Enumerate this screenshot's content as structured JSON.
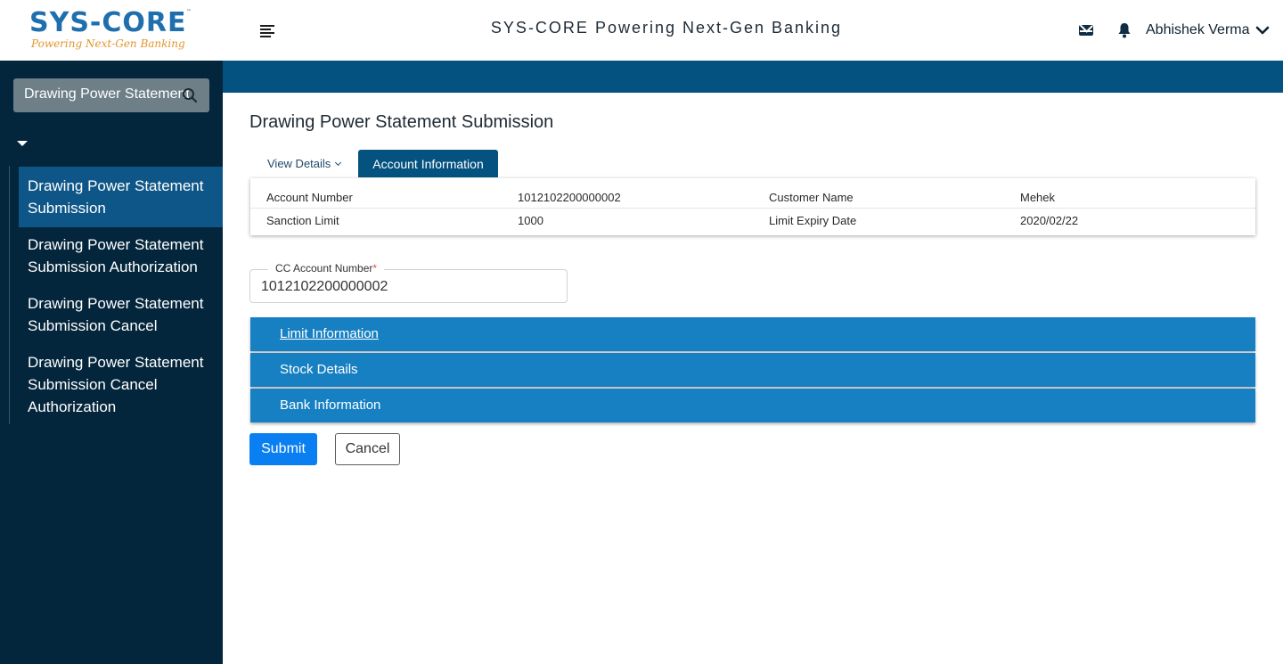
{
  "header": {
    "logo_main": "SYS-CORE",
    "logo_tm": "™",
    "logo_tagline": "Powering Next-Gen Banking",
    "title": "SYS-CORE Powering Next-Gen Banking",
    "user_name": "Abhishek Verma",
    "icons": [
      "menu-icon",
      "mail-icon",
      "bell-icon",
      "chevron-down-icon"
    ]
  },
  "sidebar": {
    "search_value": "Drawing Power Statement",
    "items": [
      {
        "label": "Drawing Power Statement Submission",
        "active": true
      },
      {
        "label": "Drawing Power Statement Submission Authorization",
        "active": false
      },
      {
        "label": "Drawing Power Statement Submission Cancel",
        "active": false
      },
      {
        "label": "Drawing Power Statement Submission Cancel Authorization",
        "active": false
      }
    ]
  },
  "main": {
    "page_title": "Drawing Power Statement Submission",
    "tabs": [
      {
        "label": "View Details"
      },
      {
        "label": "Account Information"
      }
    ],
    "account_info": {
      "rows": [
        [
          "Account Number",
          "1012102200000002",
          "Customer Name",
          "Mehek"
        ],
        [
          "Sanction Limit",
          "1000",
          "Limit Expiry Date",
          "2020/02/22"
        ]
      ]
    },
    "cc_account": {
      "label": "CC Account Number",
      "required_mark": "*",
      "value": "1012102200000002"
    },
    "sections": [
      {
        "label": "Limit Information"
      },
      {
        "label": "Stock Details"
      },
      {
        "label": "Bank Information"
      }
    ],
    "buttons": {
      "submit": "Submit",
      "cancel": "Cancel"
    }
  },
  "colors": {
    "sidebar_bg": "#04263c",
    "active_item": "#0f5688",
    "top_band": "#04527f",
    "section_bar": "#1680c2",
    "submit_button": "#0a7ff2"
  }
}
